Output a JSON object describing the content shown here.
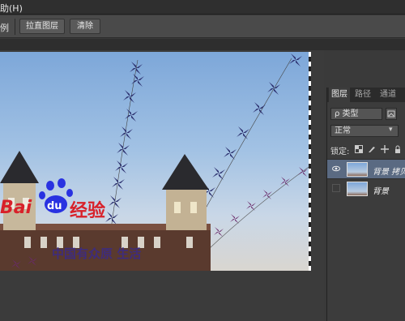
{
  "menubar": {
    "help": "助(H)"
  },
  "options": {
    "label": "例",
    "straighten_button": "拉直图层",
    "clear_button": "清除"
  },
  "canvas": {
    "logo_bai": "Bai",
    "logo_du": "du",
    "logo_cn": "经验",
    "caption": "中国有众原 生活"
  },
  "panel": {
    "tabs": [
      "图层",
      "路径",
      "通道"
    ],
    "filter_label": "ρ 类型",
    "blend_mode": "正常",
    "lock_label": "锁定:",
    "layers": [
      {
        "name": "背景 拷贝",
        "visible": true,
        "selected": true
      },
      {
        "name": "背景",
        "visible": false,
        "selected": false
      }
    ]
  },
  "colors": {
    "selection": "#5a6a82",
    "panel_bg": "#3c3c3c",
    "workspace": "#3b3b3b"
  }
}
